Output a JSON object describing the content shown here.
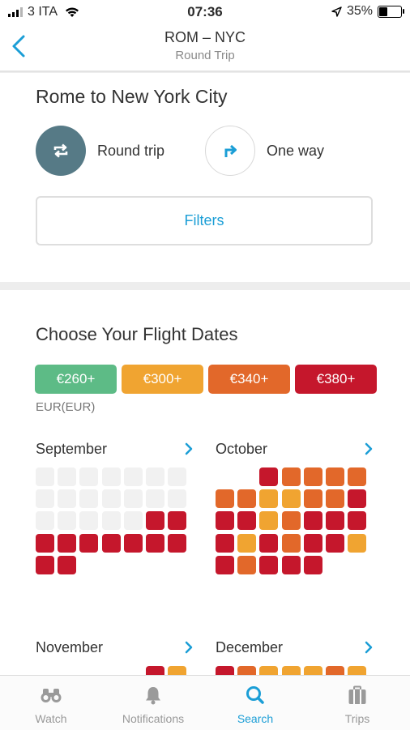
{
  "status_bar": {
    "carrier": "3 ITA",
    "time": "07:36",
    "battery_percent": "35%",
    "battery_level": 0.35
  },
  "nav": {
    "title": "ROM – NYC",
    "subtitle": "Round Trip"
  },
  "search": {
    "route_title": "Rome to New York City",
    "trip_types": [
      {
        "label": "Round trip",
        "selected": true,
        "icon": "round-trip-icon"
      },
      {
        "label": "One way",
        "selected": false,
        "icon": "one-way-arrow-icon"
      }
    ],
    "filters_label": "Filters"
  },
  "dates": {
    "title": "Choose Your Flight Dates",
    "price_legend": [
      {
        "label": "€260+",
        "color": "#5dbb86"
      },
      {
        "label": "€300+",
        "color": "#f0a431"
      },
      {
        "label": "€340+",
        "color": "#e2682a"
      },
      {
        "label": "€380+",
        "color": "#c5172c"
      }
    ],
    "currency": "EUR(EUR)",
    "colors": {
      "empty": "#f1f1f1",
      "green": "#5dbb86",
      "yellow": "#f0a431",
      "orange": "#e2682a",
      "red": "#c5172c"
    },
    "months": [
      {
        "name": "September",
        "cells": [
          "E",
          "E",
          "E",
          "E",
          "E",
          "E",
          "E",
          "E",
          "E",
          "E",
          "E",
          "E",
          "E",
          "E",
          "E",
          "E",
          "E",
          "E",
          "E",
          "R",
          "R",
          "R",
          "R",
          "R",
          "R",
          "R",
          "R",
          "R",
          "R",
          "R"
        ]
      },
      {
        "name": "October",
        "cells": [
          "_",
          "_",
          "R",
          "O",
          "O",
          "O",
          "O",
          "O",
          "O",
          "Y",
          "Y",
          "O",
          "O",
          "R",
          "R",
          "R",
          "Y",
          "O",
          "R",
          "R",
          "R",
          "R",
          "Y",
          "R",
          "O",
          "R",
          "R",
          "Y",
          "R",
          "O",
          "R",
          "R",
          "R"
        ]
      },
      {
        "name": "November",
        "cells": [
          "_",
          "_",
          "_",
          "_",
          "_",
          "R",
          "Y"
        ]
      },
      {
        "name": "December",
        "cells": [
          "R",
          "O",
          "Y",
          "Y",
          "Y",
          "O",
          "Y"
        ]
      }
    ]
  },
  "tabs": [
    {
      "label": "Watch",
      "icon": "binoculars-icon",
      "active": false
    },
    {
      "label": "Notifications",
      "icon": "bell-icon",
      "active": false
    },
    {
      "label": "Search",
      "icon": "search-icon",
      "active": true
    },
    {
      "label": "Trips",
      "icon": "suitcase-icon",
      "active": false
    }
  ]
}
